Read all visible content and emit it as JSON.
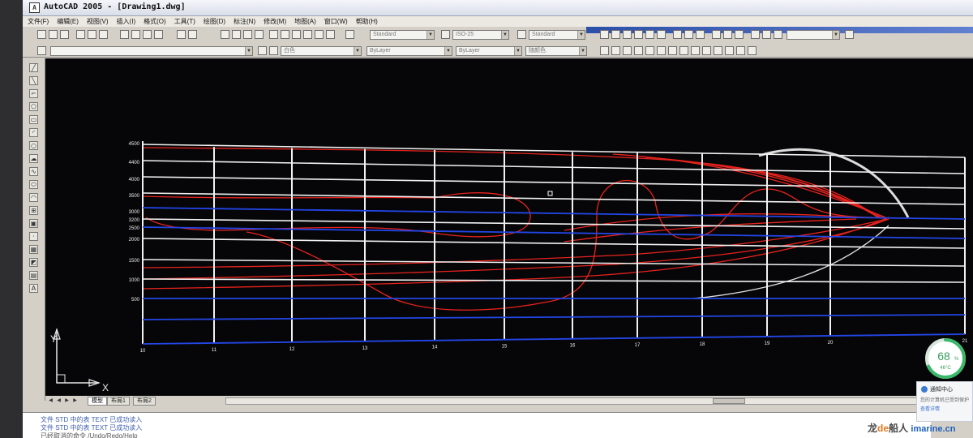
{
  "window": {
    "title": "AutoCAD 2005 - [Drawing1.dwg]",
    "app_icon": "autocad-app-icon"
  },
  "menubar": {
    "items": [
      "文件(F)",
      "编辑(E)",
      "视图(V)",
      "插入(I)",
      "格式(O)",
      "工具(T)",
      "绘图(D)",
      "标注(N)",
      "修改(M)",
      "地图(A)",
      "窗口(W)",
      "帮助(H)"
    ]
  },
  "toolbar": {
    "text_style": "Standard",
    "dim_style": "ISO-25",
    "table_style": "Standard",
    "color": "白色",
    "linetype": "ByLayer",
    "lineweight": "ByLayer",
    "plot_style": "随颜色"
  },
  "drawing": {
    "y_tick_labels": [
      "4500",
      "4400",
      "4000",
      "3500",
      "3000",
      "3200",
      "2500",
      "2000",
      "1500",
      "1000",
      "500"
    ],
    "x_tick_labels": [
      "10",
      "11",
      "12",
      "13",
      "14",
      "15",
      "16",
      "17",
      "18",
      "19",
      "20",
      "21"
    ],
    "ucs_x": "X",
    "ucs_y": "Y",
    "colors": {
      "background": "#060608",
      "grid": "#f2f2f2",
      "waterline": "#2346e6",
      "curve": "#e8231e"
    }
  },
  "layout_tabs": [
    "模型",
    "布局1",
    "布局2"
  ],
  "command_history": [
    "文件 STD 中的表 TEXT 已成功读入",
    "文件 STD 中的表 TEXT 已成功读入",
    "已经取消的命令 /Undo/Redo/Help"
  ],
  "system": {
    "gauge_value": "68",
    "gauge_unit": "%",
    "temperature": "46°C",
    "notify_title": "通知中心",
    "notify_body": "您的计算机已受到保护",
    "notify_link": "查看详情",
    "watermark_pre": "龙",
    "watermark_de": "de",
    "watermark_post": "船人",
    "watermark_url": "imarine.cn"
  }
}
